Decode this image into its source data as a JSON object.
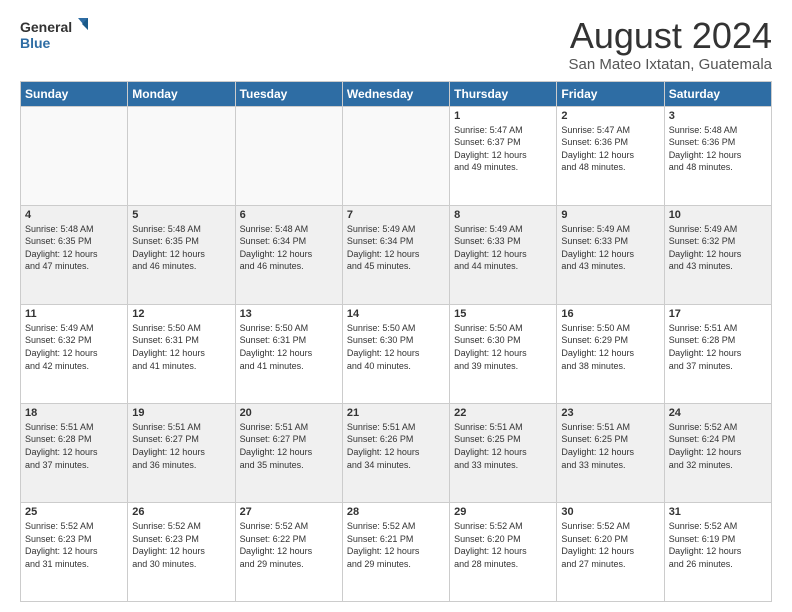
{
  "logo": {
    "line1": "General",
    "line2": "Blue"
  },
  "title": "August 2024",
  "subtitle": "San Mateo Ixtatan, Guatemala",
  "days_of_week": [
    "Sunday",
    "Monday",
    "Tuesday",
    "Wednesday",
    "Thursday",
    "Friday",
    "Saturday"
  ],
  "weeks": [
    [
      {
        "day": "",
        "info": ""
      },
      {
        "day": "",
        "info": ""
      },
      {
        "day": "",
        "info": ""
      },
      {
        "day": "",
        "info": ""
      },
      {
        "day": "1",
        "info": "Sunrise: 5:47 AM\nSunset: 6:37 PM\nDaylight: 12 hours\nand 49 minutes."
      },
      {
        "day": "2",
        "info": "Sunrise: 5:47 AM\nSunset: 6:36 PM\nDaylight: 12 hours\nand 48 minutes."
      },
      {
        "day": "3",
        "info": "Sunrise: 5:48 AM\nSunset: 6:36 PM\nDaylight: 12 hours\nand 48 minutes."
      }
    ],
    [
      {
        "day": "4",
        "info": "Sunrise: 5:48 AM\nSunset: 6:35 PM\nDaylight: 12 hours\nand 47 minutes."
      },
      {
        "day": "5",
        "info": "Sunrise: 5:48 AM\nSunset: 6:35 PM\nDaylight: 12 hours\nand 46 minutes."
      },
      {
        "day": "6",
        "info": "Sunrise: 5:48 AM\nSunset: 6:34 PM\nDaylight: 12 hours\nand 46 minutes."
      },
      {
        "day": "7",
        "info": "Sunrise: 5:49 AM\nSunset: 6:34 PM\nDaylight: 12 hours\nand 45 minutes."
      },
      {
        "day": "8",
        "info": "Sunrise: 5:49 AM\nSunset: 6:33 PM\nDaylight: 12 hours\nand 44 minutes."
      },
      {
        "day": "9",
        "info": "Sunrise: 5:49 AM\nSunset: 6:33 PM\nDaylight: 12 hours\nand 43 minutes."
      },
      {
        "day": "10",
        "info": "Sunrise: 5:49 AM\nSunset: 6:32 PM\nDaylight: 12 hours\nand 43 minutes."
      }
    ],
    [
      {
        "day": "11",
        "info": "Sunrise: 5:49 AM\nSunset: 6:32 PM\nDaylight: 12 hours\nand 42 minutes."
      },
      {
        "day": "12",
        "info": "Sunrise: 5:50 AM\nSunset: 6:31 PM\nDaylight: 12 hours\nand 41 minutes."
      },
      {
        "day": "13",
        "info": "Sunrise: 5:50 AM\nSunset: 6:31 PM\nDaylight: 12 hours\nand 41 minutes."
      },
      {
        "day": "14",
        "info": "Sunrise: 5:50 AM\nSunset: 6:30 PM\nDaylight: 12 hours\nand 40 minutes."
      },
      {
        "day": "15",
        "info": "Sunrise: 5:50 AM\nSunset: 6:30 PM\nDaylight: 12 hours\nand 39 minutes."
      },
      {
        "day": "16",
        "info": "Sunrise: 5:50 AM\nSunset: 6:29 PM\nDaylight: 12 hours\nand 38 minutes."
      },
      {
        "day": "17",
        "info": "Sunrise: 5:51 AM\nSunset: 6:28 PM\nDaylight: 12 hours\nand 37 minutes."
      }
    ],
    [
      {
        "day": "18",
        "info": "Sunrise: 5:51 AM\nSunset: 6:28 PM\nDaylight: 12 hours\nand 37 minutes."
      },
      {
        "day": "19",
        "info": "Sunrise: 5:51 AM\nSunset: 6:27 PM\nDaylight: 12 hours\nand 36 minutes."
      },
      {
        "day": "20",
        "info": "Sunrise: 5:51 AM\nSunset: 6:27 PM\nDaylight: 12 hours\nand 35 minutes."
      },
      {
        "day": "21",
        "info": "Sunrise: 5:51 AM\nSunset: 6:26 PM\nDaylight: 12 hours\nand 34 minutes."
      },
      {
        "day": "22",
        "info": "Sunrise: 5:51 AM\nSunset: 6:25 PM\nDaylight: 12 hours\nand 33 minutes."
      },
      {
        "day": "23",
        "info": "Sunrise: 5:51 AM\nSunset: 6:25 PM\nDaylight: 12 hours\nand 33 minutes."
      },
      {
        "day": "24",
        "info": "Sunrise: 5:52 AM\nSunset: 6:24 PM\nDaylight: 12 hours\nand 32 minutes."
      }
    ],
    [
      {
        "day": "25",
        "info": "Sunrise: 5:52 AM\nSunset: 6:23 PM\nDaylight: 12 hours\nand 31 minutes."
      },
      {
        "day": "26",
        "info": "Sunrise: 5:52 AM\nSunset: 6:23 PM\nDaylight: 12 hours\nand 30 minutes."
      },
      {
        "day": "27",
        "info": "Sunrise: 5:52 AM\nSunset: 6:22 PM\nDaylight: 12 hours\nand 29 minutes."
      },
      {
        "day": "28",
        "info": "Sunrise: 5:52 AM\nSunset: 6:21 PM\nDaylight: 12 hours\nand 29 minutes."
      },
      {
        "day": "29",
        "info": "Sunrise: 5:52 AM\nSunset: 6:20 PM\nDaylight: 12 hours\nand 28 minutes."
      },
      {
        "day": "30",
        "info": "Sunrise: 5:52 AM\nSunset: 6:20 PM\nDaylight: 12 hours\nand 27 minutes."
      },
      {
        "day": "31",
        "info": "Sunrise: 5:52 AM\nSunset: 6:19 PM\nDaylight: 12 hours\nand 26 minutes."
      }
    ]
  ]
}
